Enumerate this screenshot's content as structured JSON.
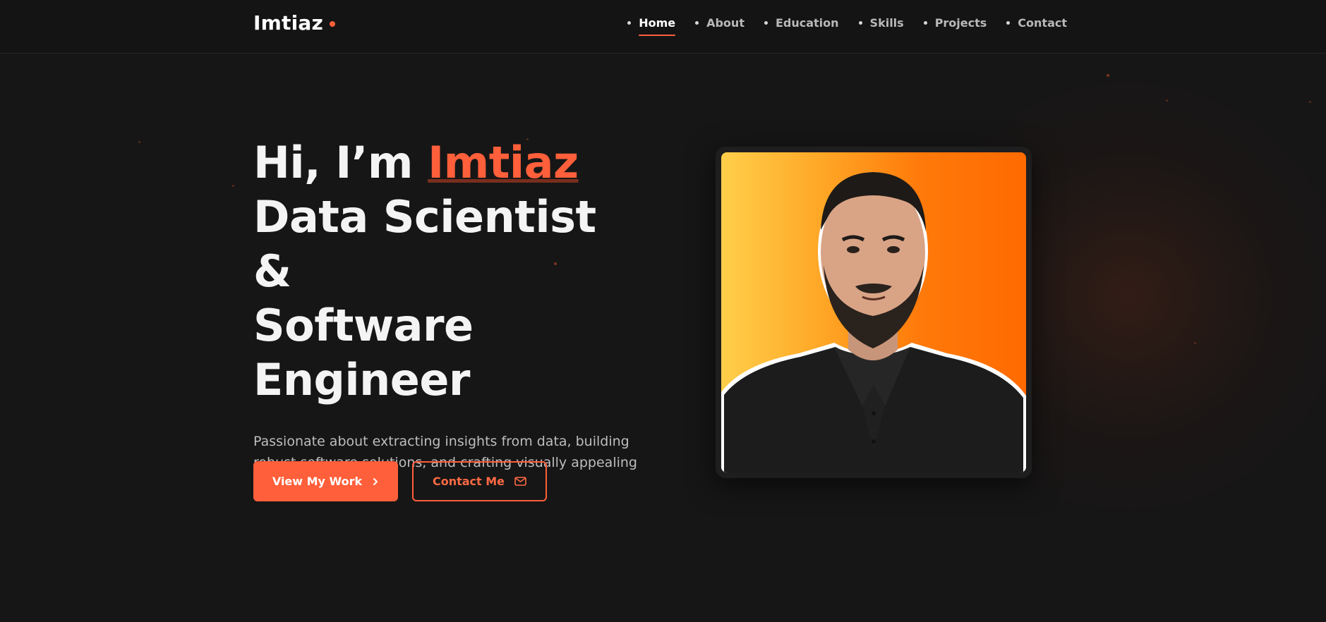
{
  "header": {
    "logo_text": "Imtiaz",
    "nav": [
      {
        "label": "Home",
        "active": true
      },
      {
        "label": "About",
        "active": false
      },
      {
        "label": "Education",
        "active": false
      },
      {
        "label": "Skills",
        "active": false
      },
      {
        "label": "Projects",
        "active": false
      },
      {
        "label": "Contact",
        "active": false
      }
    ]
  },
  "hero": {
    "greeting": "Hi, I’m ",
    "name": "Imtiaz",
    "title_line1": "Data Scientist &",
    "title_line2": "Software",
    "title_line3": "Engineer",
    "description": "Passionate about extracting insights from data, building robust software solutions, and crafting visually appealing designs.",
    "primary_button": {
      "label": "View My Work",
      "icon": "chevron-right-icon"
    },
    "secondary_button": {
      "label": "Contact Me",
      "icon": "mail-icon"
    }
  },
  "profile_image": {
    "subject": "portrait-photo"
  },
  "colors": {
    "accent": "#ff5f3a",
    "background": "#161616",
    "header_background": "#141414",
    "photo_gradient_start": "#ffcf4a",
    "photo_gradient_end": "#ff6a00"
  }
}
